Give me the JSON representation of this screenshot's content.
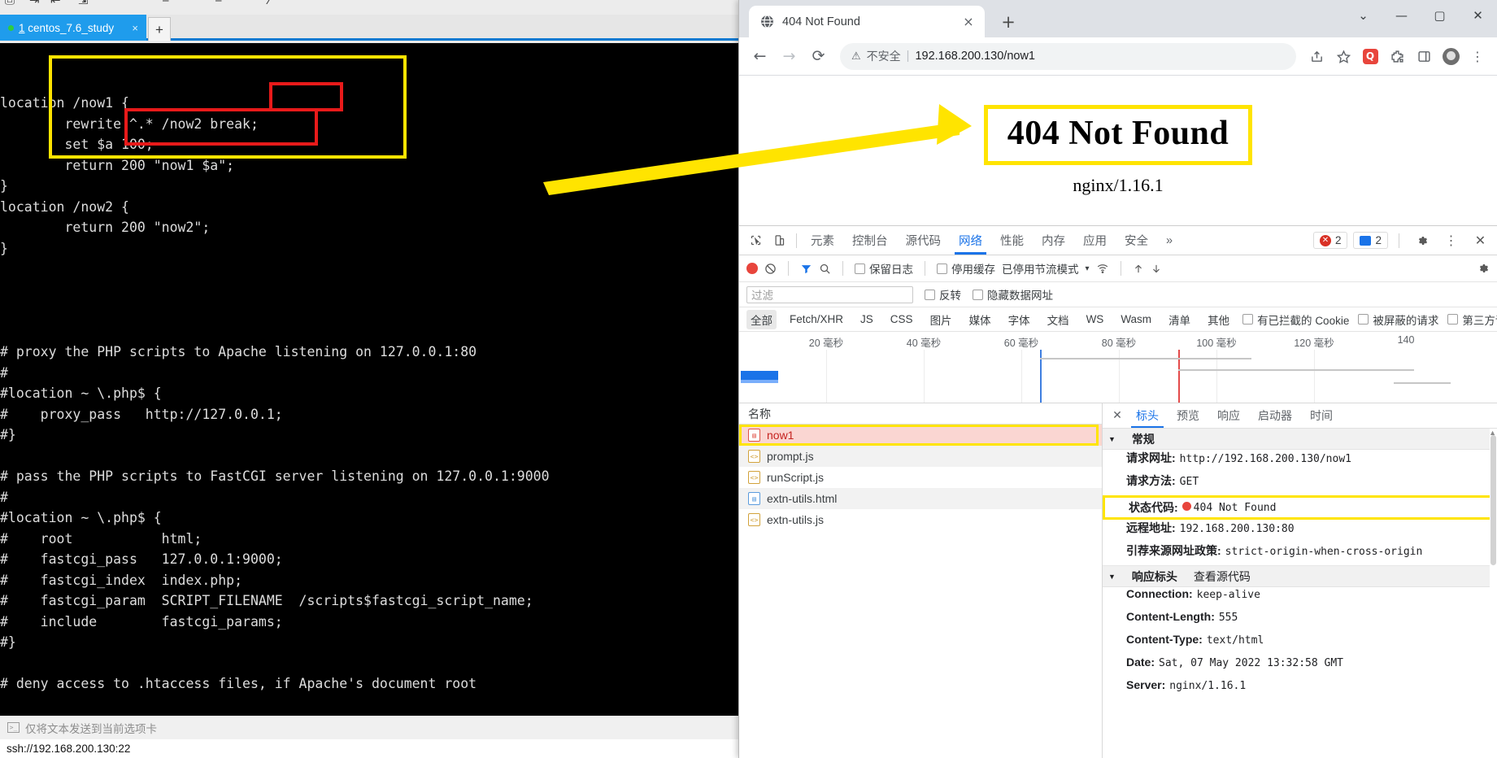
{
  "terminal": {
    "tab": {
      "index": "1",
      "title": " centos_7.6_study",
      "close": "×"
    },
    "new_tab": "+",
    "status_hint": "仅将文本发送到当前选项卡",
    "url": "ssh://192.168.200.130:22",
    "screen_lines": [
      "location /now1 {",
      "        rewrite ^.* /now2 break;",
      "        set $a 100;",
      "        return 200 \"now1 $a\";",
      "}",
      "location /now2 {",
      "        return 200 \"now2\";",
      "}",
      "",
      "",
      "",
      "",
      "# proxy the PHP scripts to Apache listening on 127.0.0.1:80",
      "#",
      "#location ~ \\.php$ {",
      "#    proxy_pass   http://127.0.0.1;",
      "#}",
      "",
      "# pass the PHP scripts to FastCGI server listening on 127.0.0.1:9000",
      "#",
      "#location ~ \\.php$ {",
      "#    root           html;",
      "#    fastcgi_pass   127.0.0.1:9000;",
      "#    fastcgi_index  index.php;",
      "#    fastcgi_param  SCRIPT_FILENAME  /scripts$fastcgi_script_name;",
      "#    include        fastcgi_params;",
      "#}",
      "",
      "# deny access to .htaccess files, if Apache's document root"
    ]
  },
  "chrome": {
    "tab": {
      "title": "404 Not Found",
      "close": "×"
    },
    "new_tab": "+",
    "window_controls": {
      "expand": "⌄",
      "minimize": "—",
      "maximize": "▢",
      "close": "✕"
    },
    "nav": {
      "back": "←",
      "forward": "→",
      "reload": "⟳"
    },
    "omnibox": {
      "warning_icon": "⚠",
      "insecure_label": "不安全",
      "divider": "|",
      "url": "192.168.200.130/now1"
    },
    "toolbar_icons": [
      "share-icon",
      "bookmark-star-icon",
      "extension-red-icon",
      "extensions-puzzle-icon",
      "side-panel-icon",
      "profile-avatar-icon",
      "chrome-menu-icon"
    ],
    "page": {
      "error_title": "404 Not Found",
      "server_signature": "nginx/1.16.1"
    }
  },
  "devtools": {
    "tabs": [
      "元素",
      "控制台",
      "源代码",
      "网络",
      "性能",
      "内存",
      "应用",
      "安全"
    ],
    "active_tab": "网络",
    "more_tabs": "»",
    "badges": {
      "errors": "2",
      "messages": "2"
    },
    "network_toolbar": {
      "record": "record-button",
      "clear": "clear-button",
      "filter": "filter-icon",
      "search": "search-icon",
      "preserve_log": "保留日志",
      "disable_cache": "停用缓存",
      "throttling": "已停用节流模式",
      "throttling_caret": "▾",
      "import": "import-har-icon",
      "export": "export-har-icon",
      "settings": "settings-gear-icon"
    },
    "filter_bar": {
      "placeholder": "过滤",
      "invert": "反转",
      "hide_data_urls": "隐藏数据网址"
    },
    "resource_types": [
      "全部",
      "Fetch/XHR",
      "JS",
      "CSS",
      "图片",
      "媒体",
      "字体",
      "文档",
      "WS",
      "Wasm",
      "清单",
      "其他"
    ],
    "selected_type": "全部",
    "type_checkboxes": [
      "有已拦截的 Cookie",
      "被屏蔽的请求",
      "第三方请求"
    ],
    "timeline_ticks": [
      "20 毫秒",
      "40 毫秒",
      "60 毫秒",
      "80 毫秒",
      "100 毫秒",
      "120 毫秒",
      "140"
    ],
    "requests": {
      "column_header": "名称",
      "rows": [
        {
          "name": "now1",
          "type": "document",
          "selected": true
        },
        {
          "name": "prompt.js",
          "type": "script",
          "selected": false
        },
        {
          "name": "runScript.js",
          "type": "script",
          "selected": false
        },
        {
          "name": "extn-utils.html",
          "type": "document",
          "selected": false
        },
        {
          "name": "extn-utils.js",
          "type": "script",
          "selected": false
        }
      ]
    },
    "detail": {
      "close": "✕",
      "tabs": [
        "标头",
        "预览",
        "响应",
        "启动器",
        "时间"
      ],
      "active_tab": "标头",
      "general": {
        "title": "常规",
        "caret": "▼",
        "items": [
          {
            "key": "请求网址:",
            "value": "http://192.168.200.130/now1",
            "highlighted": false
          },
          {
            "key": "请求方法:",
            "value": "GET",
            "highlighted": false
          },
          {
            "key": "状态代码:",
            "value": "404 Not Found",
            "highlighted": true,
            "status_dot": true
          },
          {
            "key": "远程地址:",
            "value": "192.168.200.130:80",
            "highlighted": false
          },
          {
            "key": "引荐来源网址政策:",
            "value": "strict-origin-when-cross-origin",
            "highlighted": false
          }
        ]
      },
      "response_headers": {
        "title": "响应标头",
        "caret": "▼",
        "view_source": "查看源代码",
        "items": [
          {
            "key": "Connection:",
            "value": "keep-alive"
          },
          {
            "key": "Content-Length:",
            "value": "555"
          },
          {
            "key": "Content-Type:",
            "value": "text/html"
          },
          {
            "key": "Date:",
            "value": "Sat, 07 May 2022 13:32:58 GMT"
          },
          {
            "key": "Server:",
            "value": "nginx/1.16.1"
          }
        ]
      }
    }
  },
  "colors": {
    "highlight_yellow": "#ffe400",
    "highlight_red": "#e81a1a",
    "chrome_blue": "#1a73e8",
    "terminal_bg": "#000000"
  }
}
